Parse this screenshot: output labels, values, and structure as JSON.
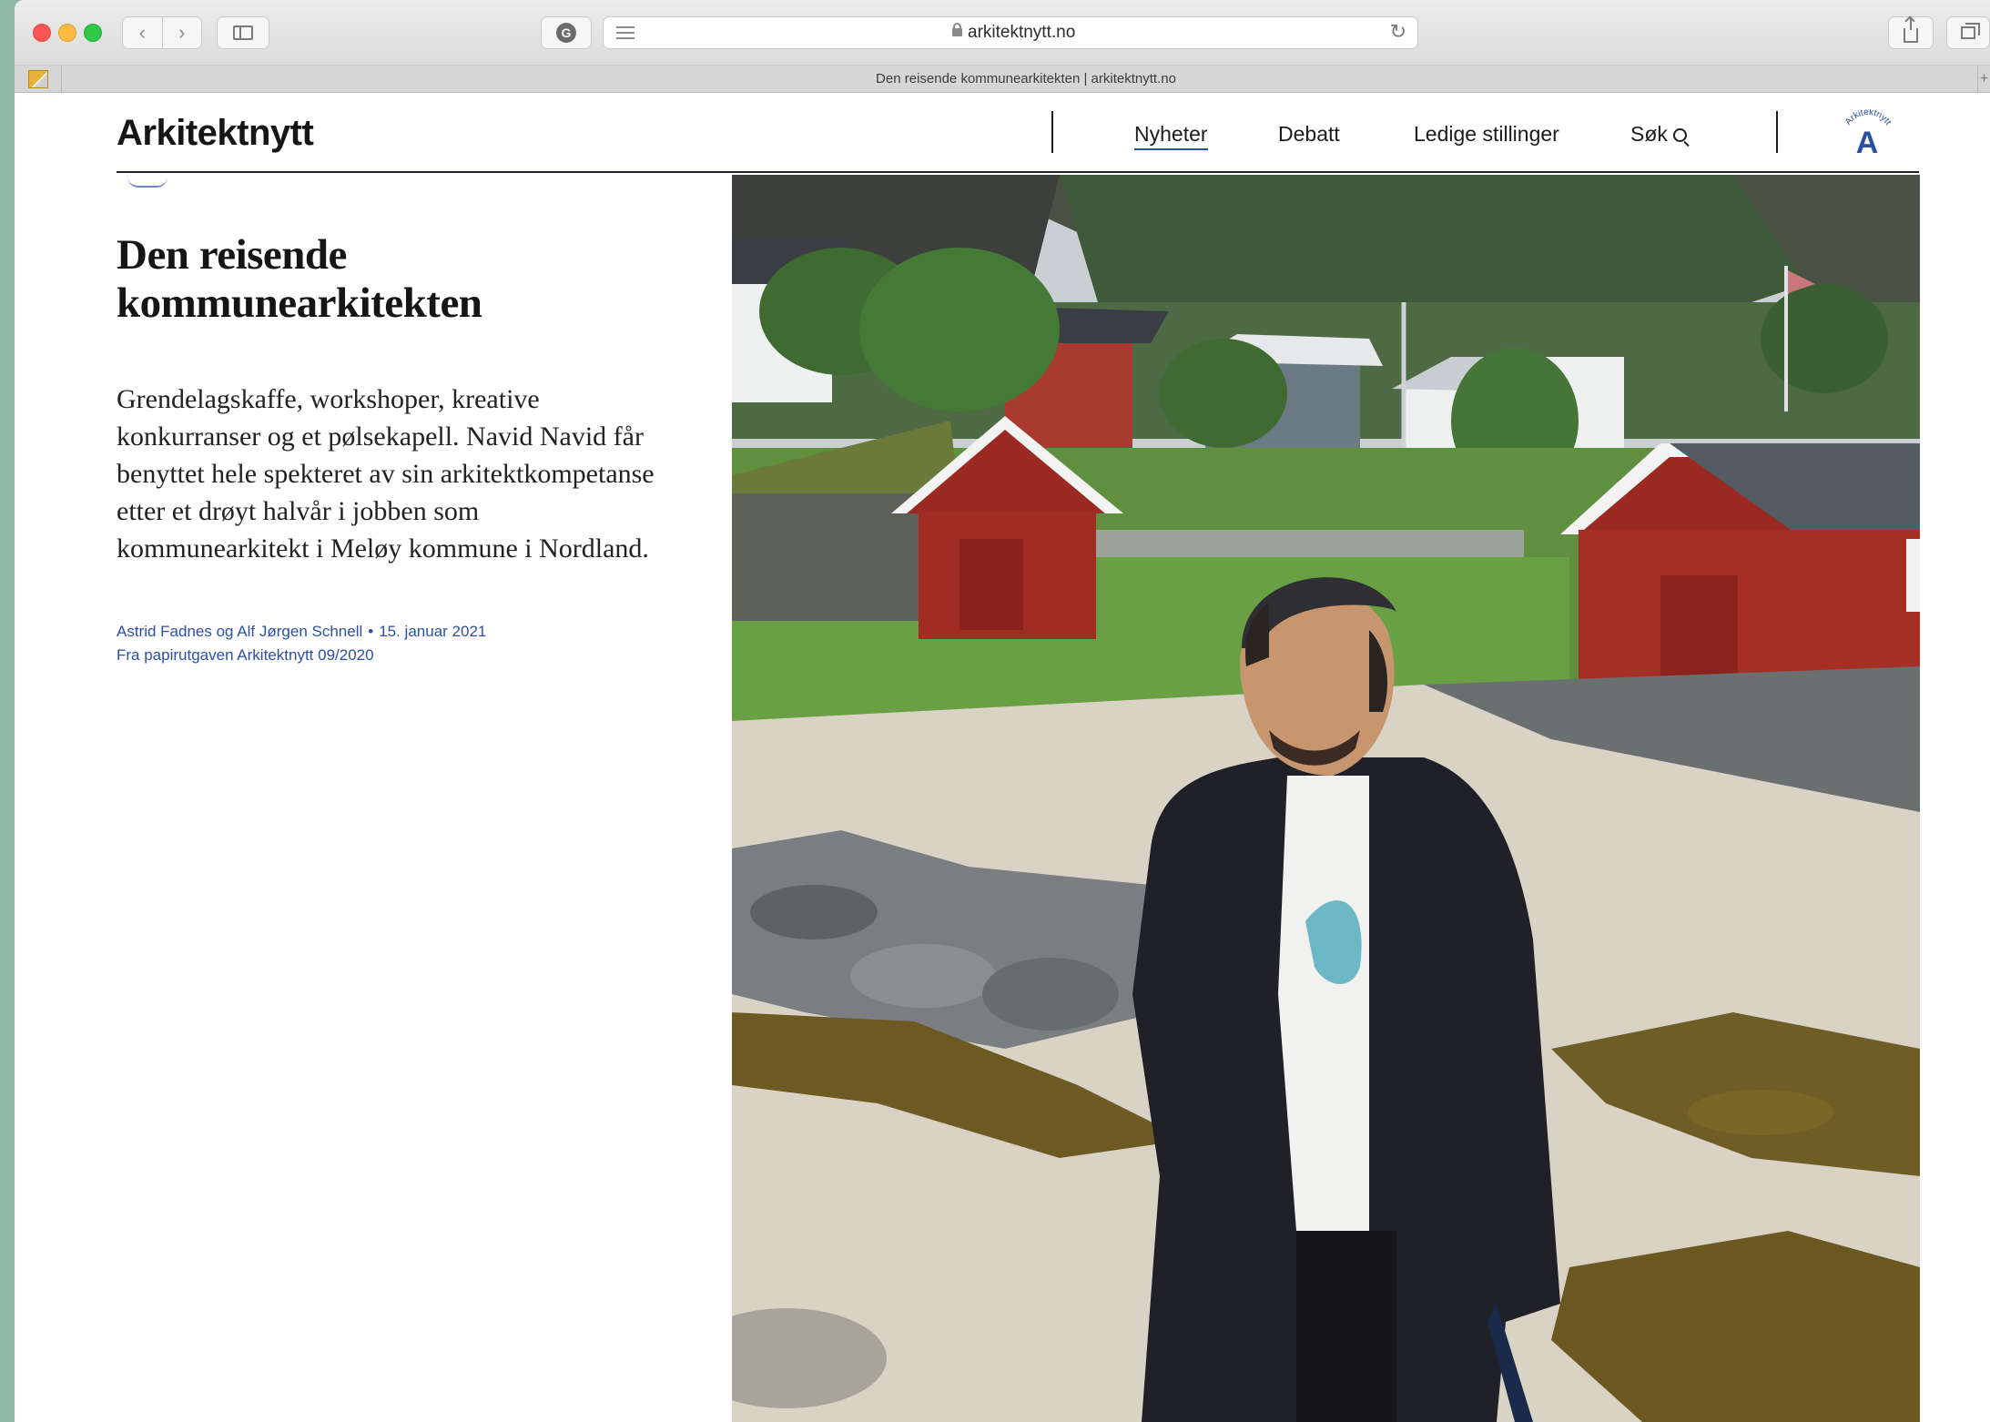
{
  "browser": {
    "url": "arkitektnytt.no",
    "tab_title": "Den reisende kommunearkitekten | arkitektnytt.no",
    "back_glyph": "‹",
    "forward_glyph": "›",
    "reload_glyph": "↻",
    "extension_glyph": "G",
    "new_tab_glyph": "+"
  },
  "site": {
    "logo": "Arkitektnytt",
    "nav": {
      "items": [
        "Nyheter",
        "Debatt",
        "Ledige stillinger"
      ],
      "search": "Søk"
    },
    "badge": {
      "arc_text": "Arkitektnytt",
      "letter": "A"
    }
  },
  "article": {
    "headline_line1": "Den reisende",
    "headline_line2": "kommunearkitekten",
    "lede": "Grendelagskaffe, workshoper, kreative konkurranser og et pølsekapell. Navid Navid får benyttet hele spekteret av sin arkitektkompetanse etter et drøyt halvår i jobben som kommunearkitekt i Meløy kommune i Nordland.",
    "authors": "Astrid Fadnes og Alf Jørgen Schnell",
    "separator": "•",
    "date": "15. januar 2021",
    "source": "Fra papirutgaven Arkitektnytt 09/2020"
  },
  "icons": {
    "close": "traffic-light-close",
    "minimize": "traffic-light-minimize",
    "maximize": "traffic-light-maximize",
    "search": "magnifier-icon"
  },
  "colors": {
    "accent": "#2c4fa6",
    "text": "#151515",
    "page_bg": "#ffffff"
  }
}
